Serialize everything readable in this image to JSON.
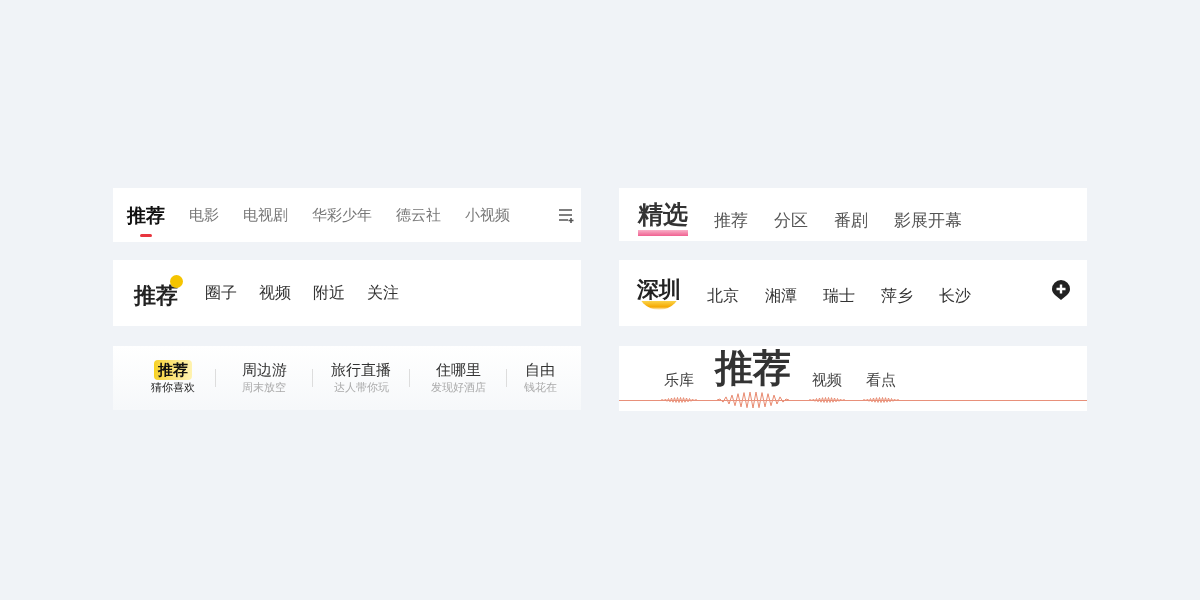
{
  "bars": [
    {
      "kind": "underline",
      "tabs": [
        {
          "label": "推荐",
          "selected": true
        },
        {
          "label": "电影",
          "selected": false
        },
        {
          "label": "电视剧",
          "selected": false
        },
        {
          "label": "华彩少年",
          "selected": false
        },
        {
          "label": "德云社",
          "selected": false
        },
        {
          "label": "小视频",
          "selected": false
        }
      ]
    },
    {
      "kind": "dot",
      "tabs": [
        {
          "label": "推荐",
          "selected": true
        },
        {
          "label": "圈子",
          "selected": false
        },
        {
          "label": "视频",
          "selected": false
        },
        {
          "label": "附近",
          "selected": false
        },
        {
          "label": "关注",
          "selected": false
        }
      ]
    },
    {
      "kind": "subtitle",
      "tabs": [
        {
          "label": "推荐",
          "sub": "猜你喜欢",
          "selected": true
        },
        {
          "label": "周边游",
          "sub": "周末放空",
          "selected": false
        },
        {
          "label": "旅行直播",
          "sub": "达人带你玩",
          "selected": false
        },
        {
          "label": "住哪里",
          "sub": "发现好酒店",
          "selected": false
        },
        {
          "label": "自由",
          "sub": "钱花在",
          "selected": false
        }
      ]
    },
    {
      "kind": "pink-brush",
      "tabs": [
        {
          "label": "精选",
          "selected": true
        },
        {
          "label": "推荐",
          "selected": false
        },
        {
          "label": "分区",
          "selected": false
        },
        {
          "label": "番剧",
          "selected": false
        },
        {
          "label": "影展开幕",
          "selected": false
        }
      ]
    },
    {
      "kind": "yellow-brush",
      "tabs": [
        {
          "label": "深圳",
          "selected": true
        },
        {
          "label": "北京",
          "selected": false
        },
        {
          "label": "湘潭",
          "selected": false
        },
        {
          "label": "瑞士",
          "selected": false
        },
        {
          "label": "萍乡",
          "selected": false
        },
        {
          "label": "长沙",
          "selected": false
        }
      ]
    },
    {
      "kind": "wave",
      "tabs": [
        {
          "label": "乐库",
          "selected": false
        },
        {
          "label": "推荐",
          "selected": true
        },
        {
          "label": "视频",
          "selected": false
        },
        {
          "label": "看点",
          "selected": false
        }
      ]
    }
  ]
}
